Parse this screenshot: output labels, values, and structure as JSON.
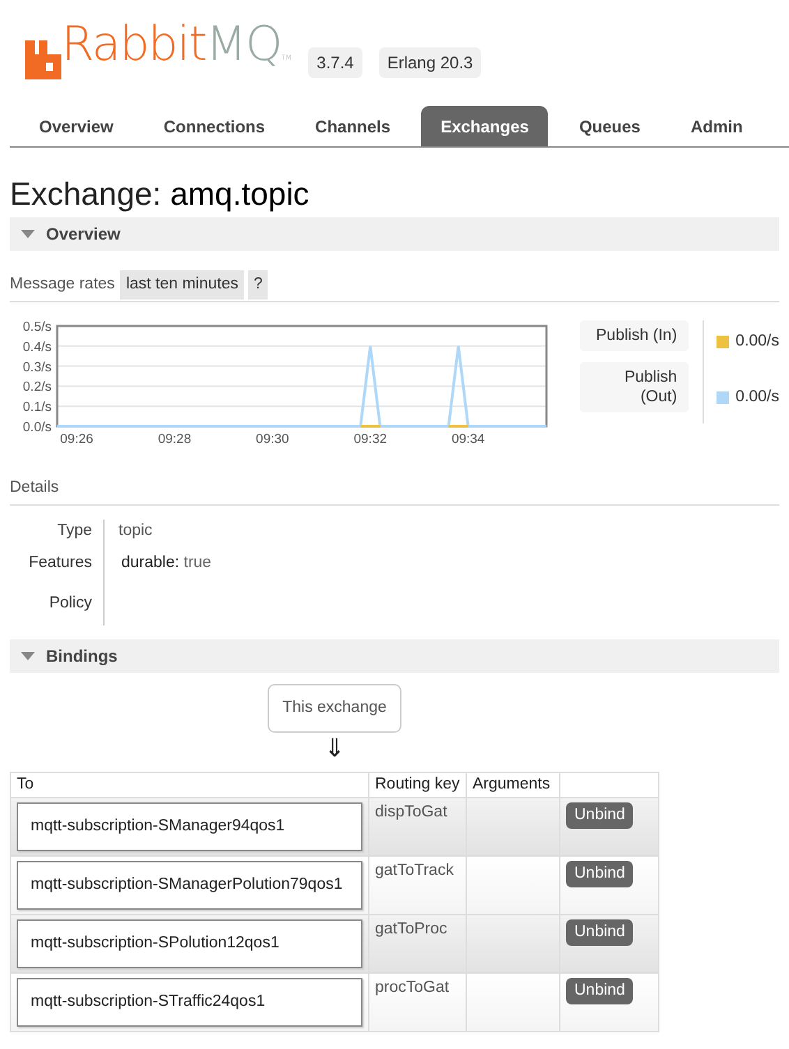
{
  "header": {
    "logo": {
      "brand_a": "Rabbit",
      "brand_b": "MQ",
      "tm": "TM"
    },
    "version": "3.7.4",
    "erlang": "Erlang 20.3"
  },
  "tabs": [
    {
      "label": "Overview",
      "selected": false
    },
    {
      "label": "Connections",
      "selected": false
    },
    {
      "label": "Channels",
      "selected": false
    },
    {
      "label": "Exchanges",
      "selected": true
    },
    {
      "label": "Queues",
      "selected": false
    },
    {
      "label": "Admin",
      "selected": false
    }
  ],
  "page_title": {
    "prefix": "Exchange:",
    "name": "amq.topic"
  },
  "overview_section": {
    "title": "Overview",
    "expanded": true
  },
  "message_rates": {
    "label": "Message rates",
    "range": "last ten minutes",
    "help": "?"
  },
  "chart_data": {
    "type": "line",
    "categories": [
      null,
      null,
      "09:26",
      null,
      null,
      null,
      null,
      null,
      null,
      null,
      null,
      null,
      "09:28",
      null,
      null,
      null,
      null,
      null,
      null,
      null,
      null,
      null,
      "09:30",
      null,
      null,
      null,
      null,
      null,
      null,
      null,
      null,
      null,
      "09:32",
      null,
      null,
      null,
      null,
      null,
      null,
      null,
      null,
      null,
      "09:34",
      null,
      null,
      null,
      null,
      null,
      null,
      null,
      null
    ],
    "ylim": [
      0,
      0.5
    ],
    "grid": true,
    "yticks": [
      {
        "value": 0,
        "label": "0.0/s"
      },
      {
        "value": 0.1,
        "label": "0.1/s"
      },
      {
        "value": 0.2,
        "label": "0.2/s"
      },
      {
        "value": 0.3,
        "label": "0.3/s"
      },
      {
        "value": 0.4,
        "label": "0.4/s"
      },
      {
        "value": 0.5,
        "label": "0.5/s"
      }
    ],
    "series": [
      {
        "name": "Publish (In)",
        "color": "#edc240",
        "values": [
          null,
          null,
          null,
          null,
          null,
          null,
          null,
          null,
          null,
          null,
          null,
          null,
          null,
          null,
          null,
          null,
          null,
          null,
          null,
          null,
          null,
          null,
          null,
          null,
          null,
          null,
          null,
          null,
          null,
          null,
          null,
          0,
          0,
          0,
          null,
          null,
          null,
          null,
          null,
          null,
          0,
          0,
          0,
          null,
          null,
          null,
          null,
          null,
          null,
          null,
          null
        ]
      },
      {
        "name": "Publish (Out)",
        "color": "#afd8f8",
        "values": [
          0,
          0,
          0,
          0,
          0,
          0,
          0,
          0,
          0,
          0,
          0,
          0,
          0,
          0,
          0,
          0,
          0,
          0,
          0,
          0,
          0,
          0,
          0,
          0,
          0,
          0,
          0,
          0,
          0,
          0,
          0,
          0,
          0.4,
          0,
          0,
          0,
          0,
          0,
          0,
          0,
          0,
          0.4,
          0,
          0,
          0,
          0,
          0,
          0,
          0,
          0,
          0
        ]
      }
    ]
  },
  "legend": [
    {
      "value": "0.00/s"
    },
    {
      "value": "0.00/s"
    }
  ],
  "details": {
    "title": "Details",
    "type_label": "Type",
    "type_value": "topic",
    "features_label": "Features",
    "features_key": "durable:",
    "features_value": "true",
    "policy_label": "Policy"
  },
  "bindings_section": {
    "title": "Bindings",
    "expanded": true
  },
  "this_exchange": "This exchange",
  "arrow": "⇓",
  "table": {
    "columns": [
      "To",
      "Routing key",
      "Arguments"
    ],
    "rows": [
      {
        "to": "mqtt-subscription-SManager94qos1",
        "routing_key": "dispToGat",
        "action": "Unbind"
      },
      {
        "to": "mqtt-subscription-SManagerPolution79qos1",
        "routing_key": "gatToTrack",
        "action": "Unbind"
      },
      {
        "to": "mqtt-subscription-SPolution12qos1",
        "routing_key": "gatToProc",
        "action": "Unbind"
      },
      {
        "to": "mqtt-subscription-STraffic24qos1",
        "routing_key": "procToGat",
        "action": "Unbind"
      }
    ]
  }
}
